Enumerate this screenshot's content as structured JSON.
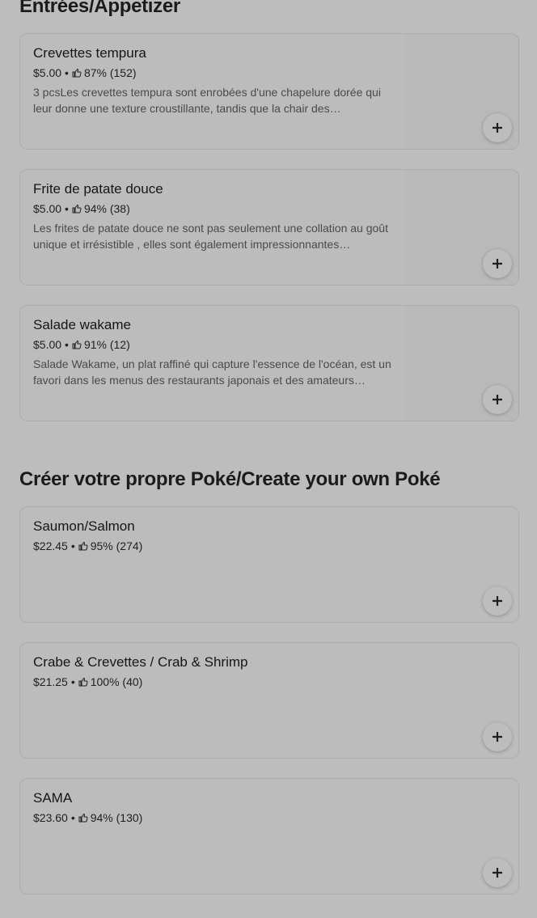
{
  "sections": [
    {
      "title": "Entrées/Appetizer",
      "items": [
        {
          "name": "Crevettes tempura",
          "price": "$5.00",
          "separator": "•",
          "rating": "87% (152)",
          "description": "3 pcsLes crevettes tempura sont enrobées d'une chapelure dorée qui leur donne une texture croustillante, tandis que la chair des…"
        },
        {
          "name": "Frite de patate douce",
          "price": "$5.00",
          "separator": "•",
          "rating": "94% (38)",
          "description": "Les frites de patate douce ne sont pas seulement une collation au goût unique et irrésistible , elles sont également impressionnantes…"
        },
        {
          "name": "Salade wakame",
          "price": "$5.00",
          "separator": "•",
          "rating": "91% (12)",
          "description": "Salade Wakame, un plat raffiné qui capture l'essence de l'océan, est un favori dans les menus des restaurants japonais et des amateurs…"
        }
      ]
    },
    {
      "title": "Créer votre propre Poké/Create your own Poké",
      "items": [
        {
          "name": "Saumon/Salmon",
          "price": "$22.45",
          "separator": "•",
          "rating": "95% (274)",
          "description": ""
        },
        {
          "name": "Crabe & Crevettes / Crab & Shrimp",
          "price": "$21.25",
          "separator": "•",
          "rating": "100% (40)",
          "description": ""
        },
        {
          "name": "SAMA",
          "price": "$23.60",
          "separator": "•",
          "rating": "94% (130)",
          "description": ""
        }
      ]
    }
  ],
  "icons": {
    "rating": "thumbs-up-icon",
    "add": "plus-icon"
  },
  "colors": {
    "background": "#bdbdbd",
    "text": "#1f1f1f",
    "muted_text": "#4a4a4a"
  }
}
